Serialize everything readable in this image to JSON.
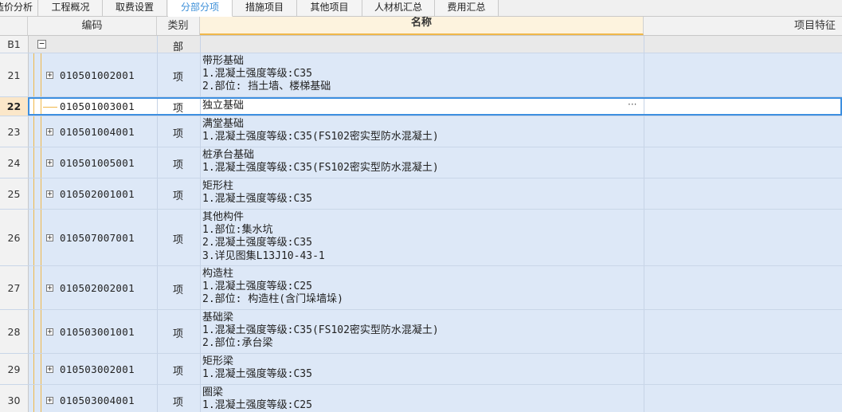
{
  "tabs": [
    {
      "label": "造价分析"
    },
    {
      "label": "工程概况"
    },
    {
      "label": "取费设置"
    },
    {
      "label": "分部分项",
      "active": true
    },
    {
      "label": "措施项目"
    },
    {
      "label": "其他项目"
    },
    {
      "label": "人材机汇总"
    },
    {
      "label": "费用汇总"
    }
  ],
  "columns": {
    "code": "编码",
    "category": "类别",
    "name": "名称",
    "feature": "项目特征"
  },
  "b1_row": {
    "num": "B1",
    "category": "部",
    "expand": "−"
  },
  "rows": [
    {
      "num": "21",
      "code": "010501002001",
      "category": "项",
      "lines": [
        "带形基础",
        "1.混凝土强度等级:C35",
        "2.部位: 挡土墙、楼梯基础"
      ]
    },
    {
      "num": "22",
      "code": "010501003001",
      "category": "项",
      "lines": [
        "独立基础"
      ],
      "selected": true
    },
    {
      "num": "23",
      "code": "010501004001",
      "category": "项",
      "lines": [
        "满堂基础",
        "1.混凝土强度等级:C35(FS102密实型防水混凝土)"
      ]
    },
    {
      "num": "24",
      "code": "010501005001",
      "category": "项",
      "lines": [
        "桩承台基础",
        "1.混凝土强度等级:C35(FS102密实型防水混凝土)"
      ]
    },
    {
      "num": "25",
      "code": "010502001001",
      "category": "项",
      "lines": [
        "矩形柱",
        "1.混凝土强度等级:C35"
      ]
    },
    {
      "num": "26",
      "code": "010507007001",
      "category": "项",
      "lines": [
        "其他构件",
        "1.部位:集水坑",
        "2.混凝土强度等级:C35",
        "3.详见图集L13J10-43-1"
      ]
    },
    {
      "num": "27",
      "code": "010502002001",
      "category": "项",
      "lines": [
        "构造柱",
        "1.混凝土强度等级:C25",
        "2.部位: 构造柱(含门垛墙垛)"
      ]
    },
    {
      "num": "28",
      "code": "010503001001",
      "category": "项",
      "lines": [
        "基础梁",
        "1.混凝土强度等级:C35(FS102密实型防水混凝土)",
        "2.部位:承台梁"
      ]
    },
    {
      "num": "29",
      "code": "010503002001",
      "category": "项",
      "lines": [
        "矩形梁",
        "1.混凝土强度等级:C35"
      ]
    },
    {
      "num": "30",
      "code": "010503004001",
      "category": "项",
      "lines": [
        "圈梁",
        "1.混凝土强度等级:C25"
      ]
    }
  ],
  "ellipsis": "···",
  "expand_glyph": "+"
}
